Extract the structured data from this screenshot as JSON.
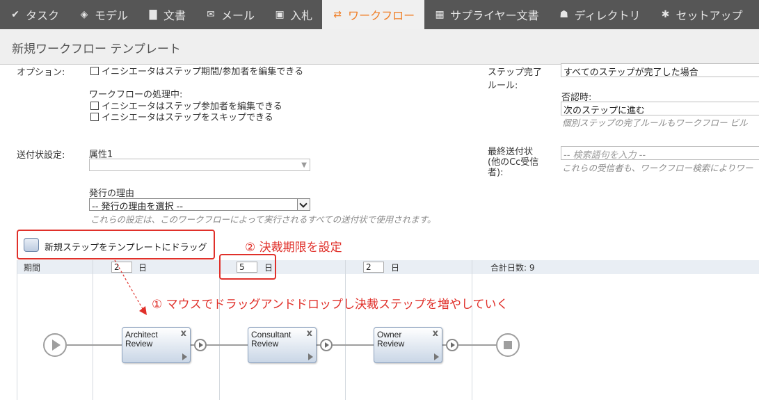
{
  "nav": {
    "tabs": [
      {
        "label": "タスク",
        "icon": "check-icon"
      },
      {
        "label": "モデル",
        "icon": "cube-icon"
      },
      {
        "label": "文書",
        "icon": "document-icon"
      },
      {
        "label": "メール",
        "icon": "mail-icon"
      },
      {
        "label": "入札",
        "icon": "bid-icon"
      },
      {
        "label": "ワークフロー",
        "icon": "workflow-icon"
      },
      {
        "label": "サプライヤー文書",
        "icon": "supplier-icon"
      },
      {
        "label": "ディレクトリ",
        "icon": "users-icon"
      },
      {
        "label": "セットアップ",
        "icon": "gear-icon"
      }
    ],
    "active_index": 5,
    "active_color": "#f07c22"
  },
  "page": {
    "title": "新規ワークフロー テンプレート"
  },
  "options": {
    "label": "オプション:",
    "opt1": "イニシエータはステップ期間/参加者を編集できる",
    "processing_label": "ワークフローの処理中:",
    "opt2": "イニシエータはステップ参加者を編集できる",
    "opt3": "イニシエータはステップをスキップできる"
  },
  "completion": {
    "label_line1": "ステップ完了",
    "label_line2": "ルール:",
    "value": "すべてのステップが完了した場合",
    "reject_label": "否認時:",
    "reject_value": "次のステップに進む",
    "hint": "個別ステップの完了ルールもワークフロー ビル"
  },
  "transmittal": {
    "label": "送付状設定:",
    "attr_label": "属性1",
    "attr_value": "",
    "reason_label": "発行の理由",
    "reason_value": "-- 発行の理由を選択 --",
    "hint": "これらの設定は、このワークフローによって実行されるすべての送付状で使用されます。"
  },
  "final_cc": {
    "label_line1": "最終送付状",
    "label_line2": "(他のCc受信",
    "label_line3": "者):",
    "placeholder": "-- 検索語句を入力 --",
    "hint": "これらの受信者も、ワークフロー検索によりワー"
  },
  "drag": {
    "label": "新規ステップをテンプレートにドラッグ"
  },
  "annotations": {
    "deadline": "② 決裁期限を設定",
    "drag_drop": "① マウスでドラッグアンドドロップし決裁ステップを増やしていく"
  },
  "duration": {
    "label": "期間",
    "unit": "日",
    "values": [
      "2",
      "5",
      "2"
    ],
    "total_label": "合計日数: 9"
  },
  "steps": [
    {
      "line1": "Architect",
      "line2": "Review"
    },
    {
      "line1": "Consultant",
      "line2": "Review"
    },
    {
      "line1": "Owner",
      "line2": "Review"
    }
  ],
  "colors": {
    "annotation_red": "#e0302a",
    "nav_bg": "#565656"
  }
}
